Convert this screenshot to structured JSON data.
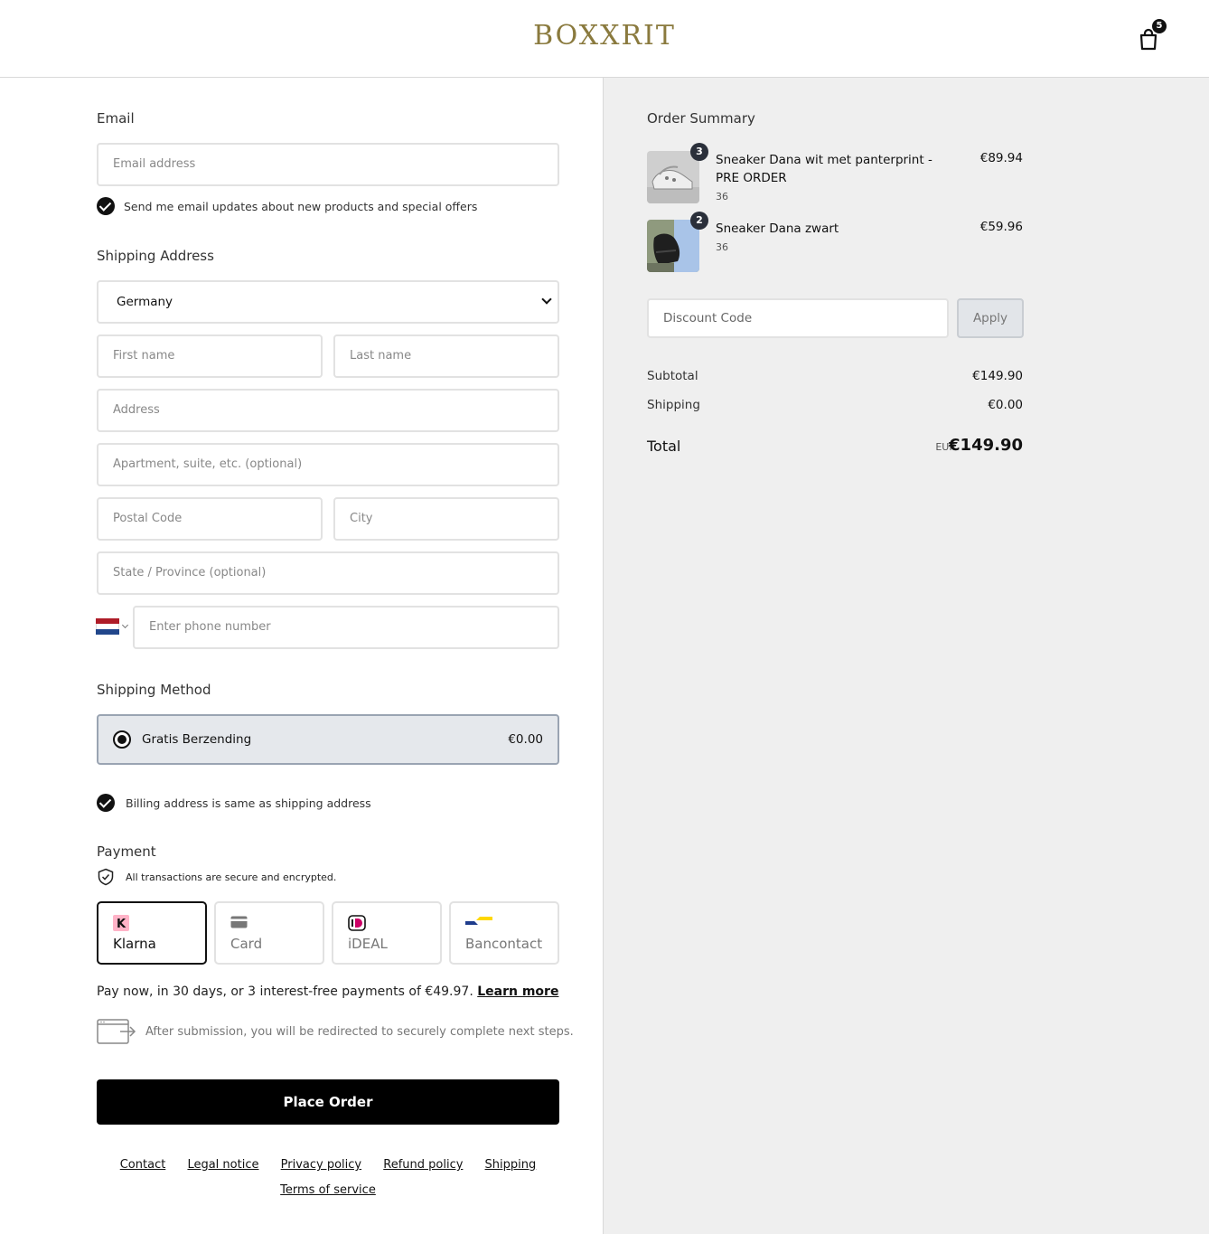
{
  "header": {
    "logo": "BOXXRIT",
    "cart_count": "5"
  },
  "contact": {
    "title": "Email",
    "email_placeholder": "Email address",
    "updates_label": "Send me email updates about new products and special offers"
  },
  "shipping_address": {
    "title": "Shipping Address",
    "country": "Germany",
    "first_name_placeholder": "First name",
    "last_name_placeholder": "Last name",
    "address_placeholder": "Address",
    "apartment_placeholder": "Apartment, suite, etc. (optional)",
    "postal_placeholder": "Postal Code",
    "city_placeholder": "City",
    "state_placeholder": "State / Province (optional)",
    "phone_placeholder": "Enter phone number",
    "phone_flag": "netherlands-flag-icon"
  },
  "shipping_method": {
    "title": "Shipping Method",
    "option_name": "Gratis Berzending",
    "option_price": "€0.00"
  },
  "billing": {
    "same_label": "Billing address is same as shipping address"
  },
  "payment": {
    "title": "Payment",
    "secure_text": "All transactions are secure and encrypted.",
    "options": [
      {
        "label": "Klarna",
        "icon": "klarna-icon",
        "selected": true
      },
      {
        "label": "Card",
        "icon": "credit-card-icon",
        "selected": false
      },
      {
        "label": "iDEAL",
        "icon": "ideal-icon",
        "selected": false
      },
      {
        "label": "Bancontact",
        "icon": "bancontact-icon",
        "selected": false
      }
    ],
    "klarna_text": "Pay now, in 30 days, or 3 interest-free payments of €49.97.",
    "learn_more": "Learn more",
    "redirect_text": "After submission, you will be redirected to securely complete next steps.",
    "place_order": "Place Order"
  },
  "footer": {
    "links": [
      "Contact",
      "Legal notice",
      "Privacy policy",
      "Refund policy",
      "Shipping"
    ],
    "links_row2": [
      "Terms of service"
    ]
  },
  "summary": {
    "title": "Order Summary",
    "items": [
      {
        "name": "Sneaker Dana wit met panterprint - PRE ORDER",
        "variant": "36",
        "price": "€89.94",
        "qty": "3"
      },
      {
        "name": "Sneaker Dana zwart",
        "variant": "36",
        "price": "€59.96",
        "qty": "2"
      }
    ],
    "discount_placeholder": "Discount Code",
    "apply_label": "Apply",
    "subtotal_label": "Subtotal",
    "subtotal_value": "€149.90",
    "shipping_label": "Shipping",
    "shipping_value": "€0.00",
    "total_label": "Total",
    "total_currency": "EUR",
    "total_value": "€149.90"
  },
  "colors": {
    "accent": "#000000",
    "logo": "#8a7a3e",
    "summary_bg": "#efefef"
  }
}
